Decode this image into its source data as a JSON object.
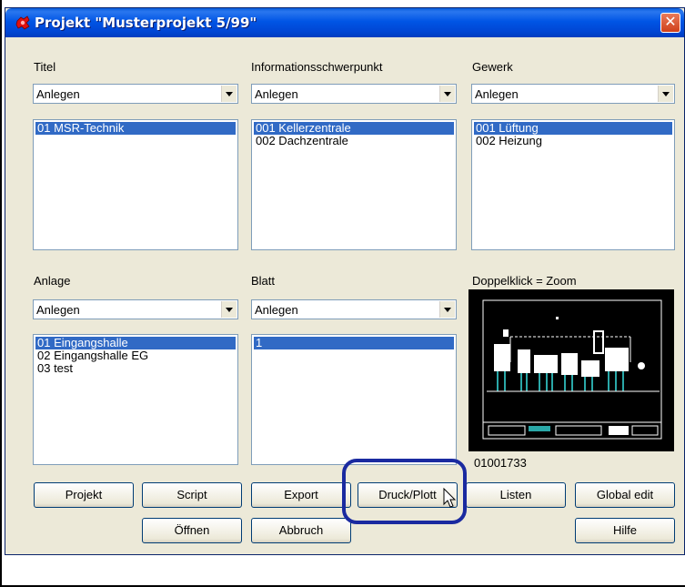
{
  "window": {
    "title": "Projekt \"Musterprojekt 5/99\"",
    "close_glyph": "✕"
  },
  "columns": [
    {
      "label": "Titel",
      "combo_value": "Anlegen",
      "items": [
        "01 MSR-Technik"
      ],
      "selected_index": 0
    },
    {
      "label": "Informationsschwerpunkt",
      "combo_value": "Anlegen",
      "items": [
        "001 Kellerzentrale",
        "002 Dachzentrale"
      ],
      "selected_index": 0
    },
    {
      "label": "Gewerk",
      "combo_value": "Anlegen",
      "items": [
        "001 Lüftung",
        "002 Heizung"
      ],
      "selected_index": 0
    },
    {
      "label": "Anlage",
      "combo_value": "Anlegen",
      "items": [
        "01 Eingangshalle",
        "02 Eingangshalle EG",
        "03 test"
      ],
      "selected_index": 0
    },
    {
      "label": "Blatt",
      "combo_value": "Anlegen",
      "items": [
        "1"
      ],
      "selected_index": 0
    }
  ],
  "preview": {
    "label": "Doppelklick = Zoom",
    "drawing_number": "01001733"
  },
  "buttons": {
    "projekt": "Projekt",
    "script": "Script",
    "export": "Export",
    "druck_plott": "Druck/Plott",
    "listen": "Listen",
    "global_edit": "Global edit",
    "oeffnen": "Öffnen",
    "abbruch": "Abbruch",
    "hilfe": "Hilfe"
  },
  "colors": {
    "selection": "#316ac5",
    "highlight_ring": "#1a2aa0",
    "titlebar": "#0055e5"
  }
}
